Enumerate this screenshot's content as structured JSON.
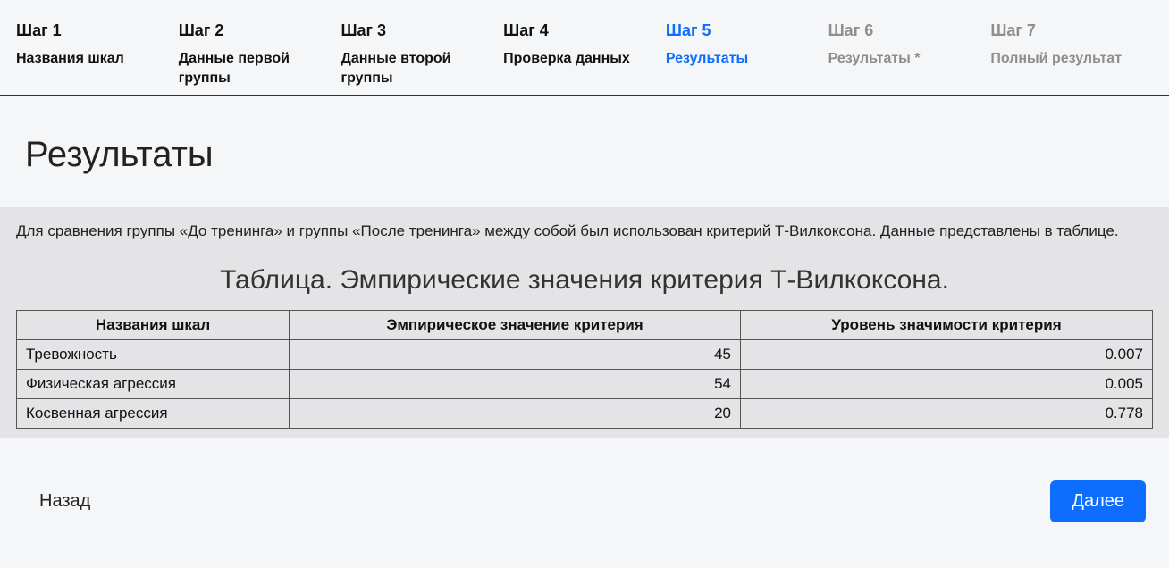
{
  "steps": [
    {
      "title": "Шаг 1",
      "sub": "Названия шкал",
      "state": "normal"
    },
    {
      "title": "Шаг 2",
      "sub": "Данные первой группы",
      "state": "normal"
    },
    {
      "title": "Шаг 3",
      "sub": "Данные второй группы",
      "state": "normal"
    },
    {
      "title": "Шаг 4",
      "sub": "Проверка данных",
      "state": "normal"
    },
    {
      "title": "Шаг 5",
      "sub": "Результаты",
      "state": "active"
    },
    {
      "title": "Шаг 6",
      "sub": "Результаты *",
      "state": "muted"
    },
    {
      "title": "Шаг 7",
      "sub": "Полный результат",
      "state": "muted"
    }
  ],
  "page_title": "Результаты",
  "description": "Для сравнения группы «До тренинга» и группы «После тренинга» между собой был использован критерий Т-Вилкоксона. Данные представлены в таблице.",
  "table_caption": "Таблица. Эмпирические значения критерия Т-Вилкоксона.",
  "table": {
    "headers": [
      "Названия шкал",
      "Эмпирическое значение критерия",
      "Уровень значимости критерия"
    ],
    "rows": [
      {
        "name": "Тревожность",
        "emp": "45",
        "sig": "0.007"
      },
      {
        "name": "Физическая агрессия",
        "emp": "54",
        "sig": "0.005"
      },
      {
        "name": "Косвенная агрессия",
        "emp": "20",
        "sig": "0.778"
      }
    ]
  },
  "buttons": {
    "back": "Назад",
    "next": "Далее"
  }
}
